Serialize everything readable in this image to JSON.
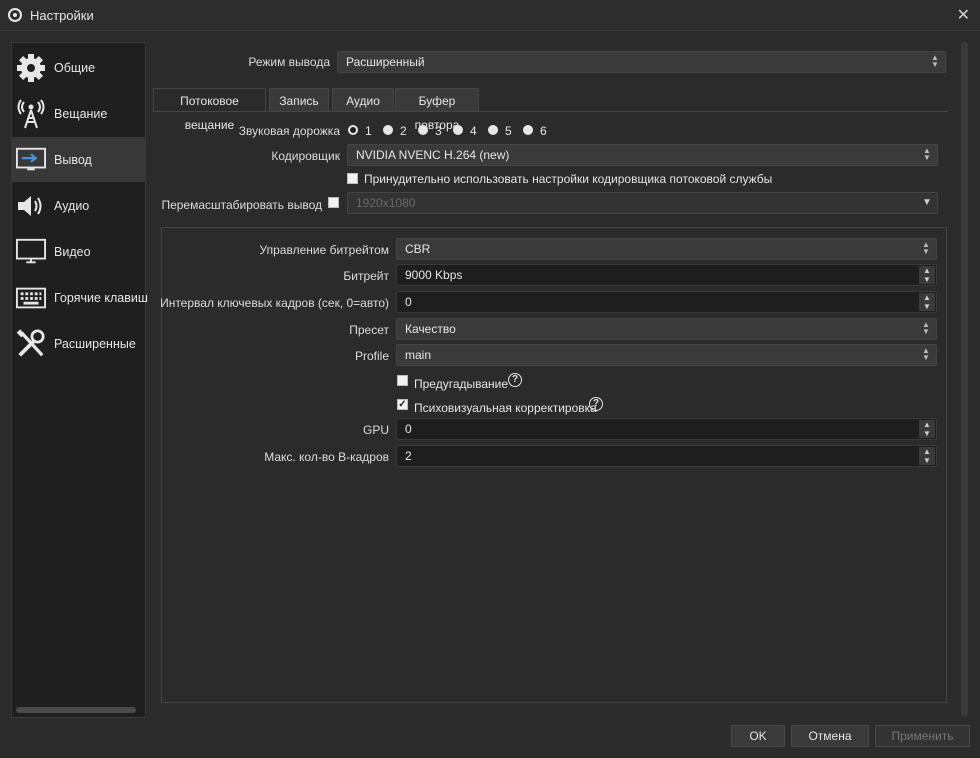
{
  "window": {
    "title": "Настройки",
    "close_glyph": "✕"
  },
  "sidebar": {
    "items": [
      {
        "label": "Общие",
        "icon": "gear-icon"
      },
      {
        "label": "Вещание",
        "icon": "broadcast-tower-icon"
      },
      {
        "label": "Вывод",
        "icon": "output-monitor-arrow-icon",
        "active": true
      },
      {
        "label": "Аудио",
        "icon": "speaker-icon"
      },
      {
        "label": "Видео",
        "icon": "monitor-icon"
      },
      {
        "label": "Горячие клавиш",
        "icon": "keyboard-icon"
      },
      {
        "label": "Расширенные",
        "icon": "tools-icon"
      }
    ]
  },
  "output_mode": {
    "label": "Режим вывода",
    "value": "Расширенный"
  },
  "tabs": [
    "Потоковое вещание",
    "Запись",
    "Аудио",
    "Буфер повтора"
  ],
  "audio_track": {
    "label": "Звуковая дорожка",
    "options": [
      "1",
      "2",
      "3",
      "4",
      "5",
      "6"
    ],
    "selected": "1"
  },
  "encoder": {
    "label": "Кодировщик",
    "value": "NVIDIA NVENC H.264 (new)"
  },
  "enforce": {
    "label": "Принудительно использовать настройки кодировщика потоковой службы",
    "checked": false
  },
  "rescale": {
    "label": "Перемасштабировать вывод",
    "value": "1920x1080",
    "checked": false
  },
  "encoder_settings": {
    "rate_control": {
      "label": "Управление битрейтом",
      "value": "CBR"
    },
    "bitrate": {
      "label": "Битрейт",
      "value": "9000 Kbps"
    },
    "keyframe": {
      "label": "Интервал ключевых кадров (сек, 0=авто)",
      "value": "0"
    },
    "preset": {
      "label": "Пресет",
      "value": "Качество"
    },
    "profile": {
      "label": "Profile",
      "value": "main"
    },
    "lookahead": {
      "label": "Предугадывание",
      "checked": false
    },
    "psycho": {
      "label": "Психовизуальная корректировка",
      "checked": true
    },
    "gpu": {
      "label": "GPU",
      "value": "0"
    },
    "bframes": {
      "label": "Макс. кол-во B-кадров",
      "value": "2"
    }
  },
  "buttons": {
    "ok": "OK",
    "cancel": "Отмена",
    "apply": "Применить"
  },
  "glyphs": {
    "up": "▲",
    "down": "▼",
    "updown": "⌃⌄",
    "check": "✓",
    "help": "?"
  }
}
